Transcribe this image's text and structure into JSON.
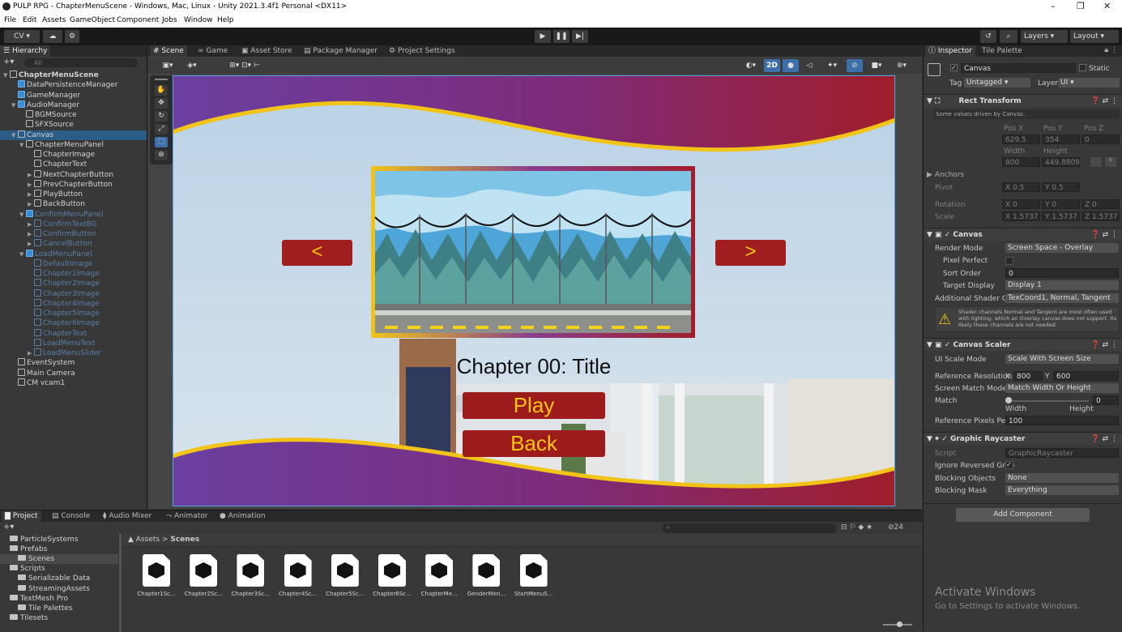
{
  "window": {
    "title": "PULP RPG - ChapterMenuScene - Windows, Mac, Linux - Unity 2021.3.4f1 Personal <DX11>",
    "minimize": "–",
    "maximize": "❐",
    "close": "✕"
  },
  "menu": [
    "File",
    "Edit",
    "Assets",
    "GameObject",
    "Component",
    "Jobs",
    "Window",
    "Help"
  ],
  "toolbar": {
    "account": "CV ▾",
    "layers": "Layers",
    "layout": "Layout"
  },
  "hierarchy": {
    "tab": "Hierarchy",
    "search_placeholder": "All",
    "rows": [
      {
        "label": "ChapterMenuScene",
        "indent": 0,
        "kind": "scene",
        "arrow": "▼"
      },
      {
        "label": "DataPersistenceManager",
        "indent": 1,
        "kind": "blue",
        "arrow": ""
      },
      {
        "label": "GameManager",
        "indent": 1,
        "kind": "blue",
        "arrow": ""
      },
      {
        "label": "AudioManager",
        "indent": 1,
        "kind": "blue",
        "arrow": "▼"
      },
      {
        "label": "BGMSource",
        "indent": 2,
        "kind": "plain",
        "arrow": ""
      },
      {
        "label": "SFXSource",
        "indent": 2,
        "kind": "plain",
        "arrow": ""
      },
      {
        "label": "Canvas",
        "indent": 1,
        "kind": "plain",
        "arrow": "▼",
        "selected": true
      },
      {
        "label": "ChapterMenuPanel",
        "indent": 2,
        "kind": "plain",
        "arrow": "▼"
      },
      {
        "label": "ChapterImage",
        "indent": 3,
        "kind": "plain",
        "arrow": ""
      },
      {
        "label": "ChapterText",
        "indent": 3,
        "kind": "plain",
        "arrow": ""
      },
      {
        "label": "NextChapterButton",
        "indent": 3,
        "kind": "plain",
        "arrow": "▶"
      },
      {
        "label": "PrevChapterButton",
        "indent": 3,
        "kind": "plain",
        "arrow": "▶"
      },
      {
        "label": "PlayButton",
        "indent": 3,
        "kind": "plain",
        "arrow": "▶"
      },
      {
        "label": "BackButton",
        "indent": 3,
        "kind": "plain",
        "arrow": "▶"
      },
      {
        "label": "ConfirmMenuPanel",
        "indent": 2,
        "kind": "dimblue",
        "arrow": "▼"
      },
      {
        "label": "ConfirmTextBG",
        "indent": 3,
        "kind": "dim",
        "arrow": "▶"
      },
      {
        "label": "ConfirmButton",
        "indent": 3,
        "kind": "dim",
        "arrow": "▶"
      },
      {
        "label": "CancelButton",
        "indent": 3,
        "kind": "dim",
        "arrow": "▶"
      },
      {
        "label": "LoadMenuPanel",
        "indent": 2,
        "kind": "dimblue",
        "arrow": "▼"
      },
      {
        "label": "DefaultImage",
        "indent": 3,
        "kind": "dim",
        "arrow": ""
      },
      {
        "label": "Chapter1Image",
        "indent": 3,
        "kind": "dim",
        "arrow": ""
      },
      {
        "label": "Chapter2Image",
        "indent": 3,
        "kind": "dim",
        "arrow": ""
      },
      {
        "label": "Chapter3Image",
        "indent": 3,
        "kind": "dim",
        "arrow": ""
      },
      {
        "label": "Chapter4Image",
        "indent": 3,
        "kind": "dim",
        "arrow": ""
      },
      {
        "label": "Chapter5Image",
        "indent": 3,
        "kind": "dim",
        "arrow": ""
      },
      {
        "label": "Chapter6Image",
        "indent": 3,
        "kind": "dim",
        "arrow": ""
      },
      {
        "label": "ChapterText",
        "indent": 3,
        "kind": "dim",
        "arrow": ""
      },
      {
        "label": "LoadMenuText",
        "indent": 3,
        "kind": "dim",
        "arrow": ""
      },
      {
        "label": "LoadMenuSlider",
        "indent": 3,
        "kind": "dim",
        "arrow": "▶"
      },
      {
        "label": "EventSystem",
        "indent": 1,
        "kind": "plain",
        "arrow": ""
      },
      {
        "label": "Main Camera",
        "indent": 1,
        "kind": "plain",
        "arrow": ""
      },
      {
        "label": "CM vcam1",
        "indent": 1,
        "kind": "plain",
        "arrow": ""
      }
    ]
  },
  "scene_tabs": [
    "Scene",
    "Game",
    "Asset Store",
    "Package Manager",
    "Project Settings"
  ],
  "scene_toolbar": {
    "mode_2d": "2D"
  },
  "game_ui": {
    "prev": "<",
    "next": ">",
    "chapter_title": "Chapter 00: Title",
    "play": "Play",
    "back": "Back"
  },
  "inspector": {
    "tabs": [
      "Inspector",
      "Tile Palette"
    ],
    "object_name": "Canvas",
    "static": "Static",
    "tag_label": "Tag",
    "tag": "Untagged",
    "layer_label": "Layer",
    "layer": "UI",
    "rect_transform": {
      "title": "Rect Transform",
      "note": "Some values driven by Canvas.",
      "pos_x_label": "Pos X",
      "pos_y_label": "Pos Y",
      "pos_z_label": "Pos Z",
      "pos_x": "629.5",
      "pos_y": "354",
      "pos_z": "0",
      "width_label": "Width",
      "height_label": "Height",
      "width": "800",
      "height": "449.8809",
      "anchors": "Anchors",
      "pivot_label": "Pivot",
      "pivot_x": "X 0.5",
      "pivot_y": "Y 0.5",
      "rotation_label": "Rotation",
      "rot_x": "X 0",
      "rot_y": "Y 0",
      "rot_z": "Z 0",
      "scale_label": "Scale",
      "scale_x": "X 1.5737",
      "scale_y": "Y 1.5737",
      "scale_z": "Z 1.5737"
    },
    "canvas": {
      "title": "Canvas",
      "render_mode_label": "Render Mode",
      "render_mode": "Screen Space - Overlay",
      "pixel_perfect_label": "Pixel Perfect",
      "sort_order_label": "Sort Order",
      "sort_order": "0",
      "target_display_label": "Target Display",
      "target_display": "Display 1",
      "shader_label": "Additional Shader Ch",
      "shader": "TexCoord1, Normal, Tangent",
      "warning": "Shader channels Normal and Tangent are most often used with lighting, which an Overlay canvas does not support. Its likely these channels are not needed."
    },
    "canvas_scaler": {
      "title": "Canvas Scaler",
      "scale_mode_label": "UI Scale Mode",
      "scale_mode": "Scale With Screen Size",
      "ref_res_label": "Reference Resolution",
      "ref_x": "800",
      "ref_y": "600",
      "match_mode_label": "Screen Match Mode",
      "match_mode": "Match Width Or Height",
      "match_label": "Match",
      "match_value": "0",
      "match_width": "Width",
      "match_height": "Height",
      "ppu_label": "Reference Pixels Per",
      "ppu": "100"
    },
    "raycaster": {
      "title": "Graphic Raycaster",
      "script_label": "Script",
      "script": "GraphicRaycaster",
      "ignore_label": "Ignore Reversed Grap",
      "blocking_objects_label": "Blocking Objects",
      "blocking_objects": "None",
      "blocking_mask_label": "Blocking Mask",
      "blocking_mask": "Everything"
    },
    "add_component": "Add Component",
    "activate_title": "Activate Windows",
    "activate_sub": "Go to Settings to activate Windows."
  },
  "bottom_tabs": [
    "Project",
    "Console",
    "Audio Mixer",
    "Animator",
    "Animation"
  ],
  "project": {
    "folders": [
      "ParticleSystems",
      "Prefabs",
      "Scenes",
      "Scripts",
      "Serializable Data",
      "StreamingAssets",
      "TextMesh Pro",
      "Tile Palettes",
      "Tilesets"
    ],
    "breadcrumb_root": "Assets",
    "breadcrumb_sep": ">",
    "breadcrumb_leaf": "Scenes",
    "hidden_count": "24",
    "assets": [
      "Chapter1Sc...",
      "Chapter2Sc...",
      "Chapter3Sc...",
      "Chapter4Sc...",
      "Chapter5Sc...",
      "Chapter6Sc...",
      "ChapterMe...",
      "GenderMen...",
      "StartMenuS..."
    ]
  }
}
